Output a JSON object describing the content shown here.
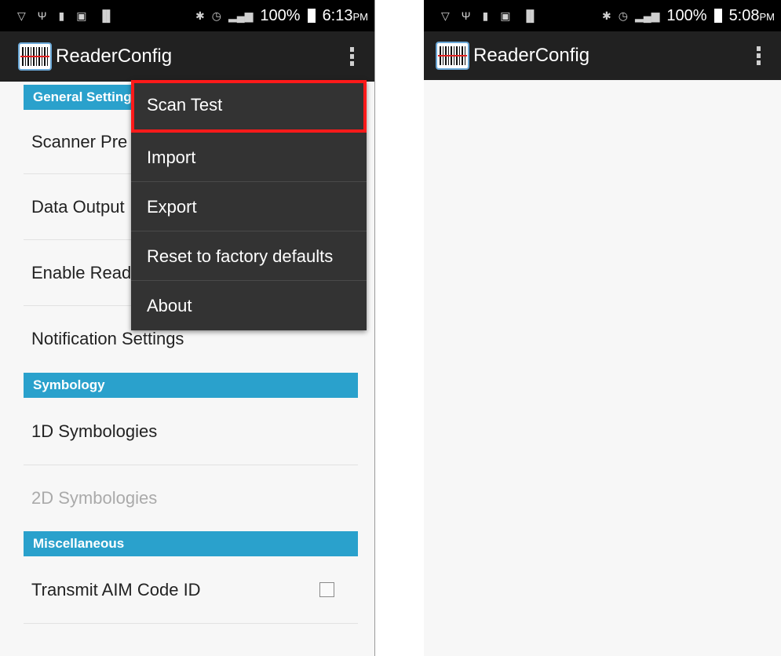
{
  "left": {
    "status": {
      "battery": "100%",
      "time": "6:13",
      "ampm": "PM"
    },
    "app_title": "ReaderConfig",
    "sections": [
      {
        "header": "General Setting",
        "items": [
          {
            "label": "Scanner Pre",
            "top": 0
          },
          {
            "label": "Data Output",
            "top": 0
          },
          {
            "label": "Enable Read",
            "top": 0
          },
          {
            "label": "Notification Settings",
            "top": 0
          }
        ]
      },
      {
        "header": "Symbology",
        "items": [
          {
            "label": "1D Symbologies"
          },
          {
            "label": "2D Symbologies",
            "disabled": true
          }
        ]
      },
      {
        "header": "Miscellaneous",
        "items": [
          {
            "label": "Transmit AIM Code ID",
            "checkbox": false
          }
        ]
      }
    ],
    "menu": {
      "items": [
        "Scan Test",
        "Import",
        "Export",
        "Reset to factory defaults",
        "About"
      ],
      "highlighted": "Scan Test"
    }
  },
  "right": {
    "status": {
      "battery": "100%",
      "time": "5:08",
      "ampm": "PM"
    },
    "app_title": "ReaderConfig"
  },
  "colors": {
    "accent": "#2aa1cc",
    "highlight": "#ff1a1a",
    "actionbar": "#212121",
    "menu": "#333333"
  }
}
